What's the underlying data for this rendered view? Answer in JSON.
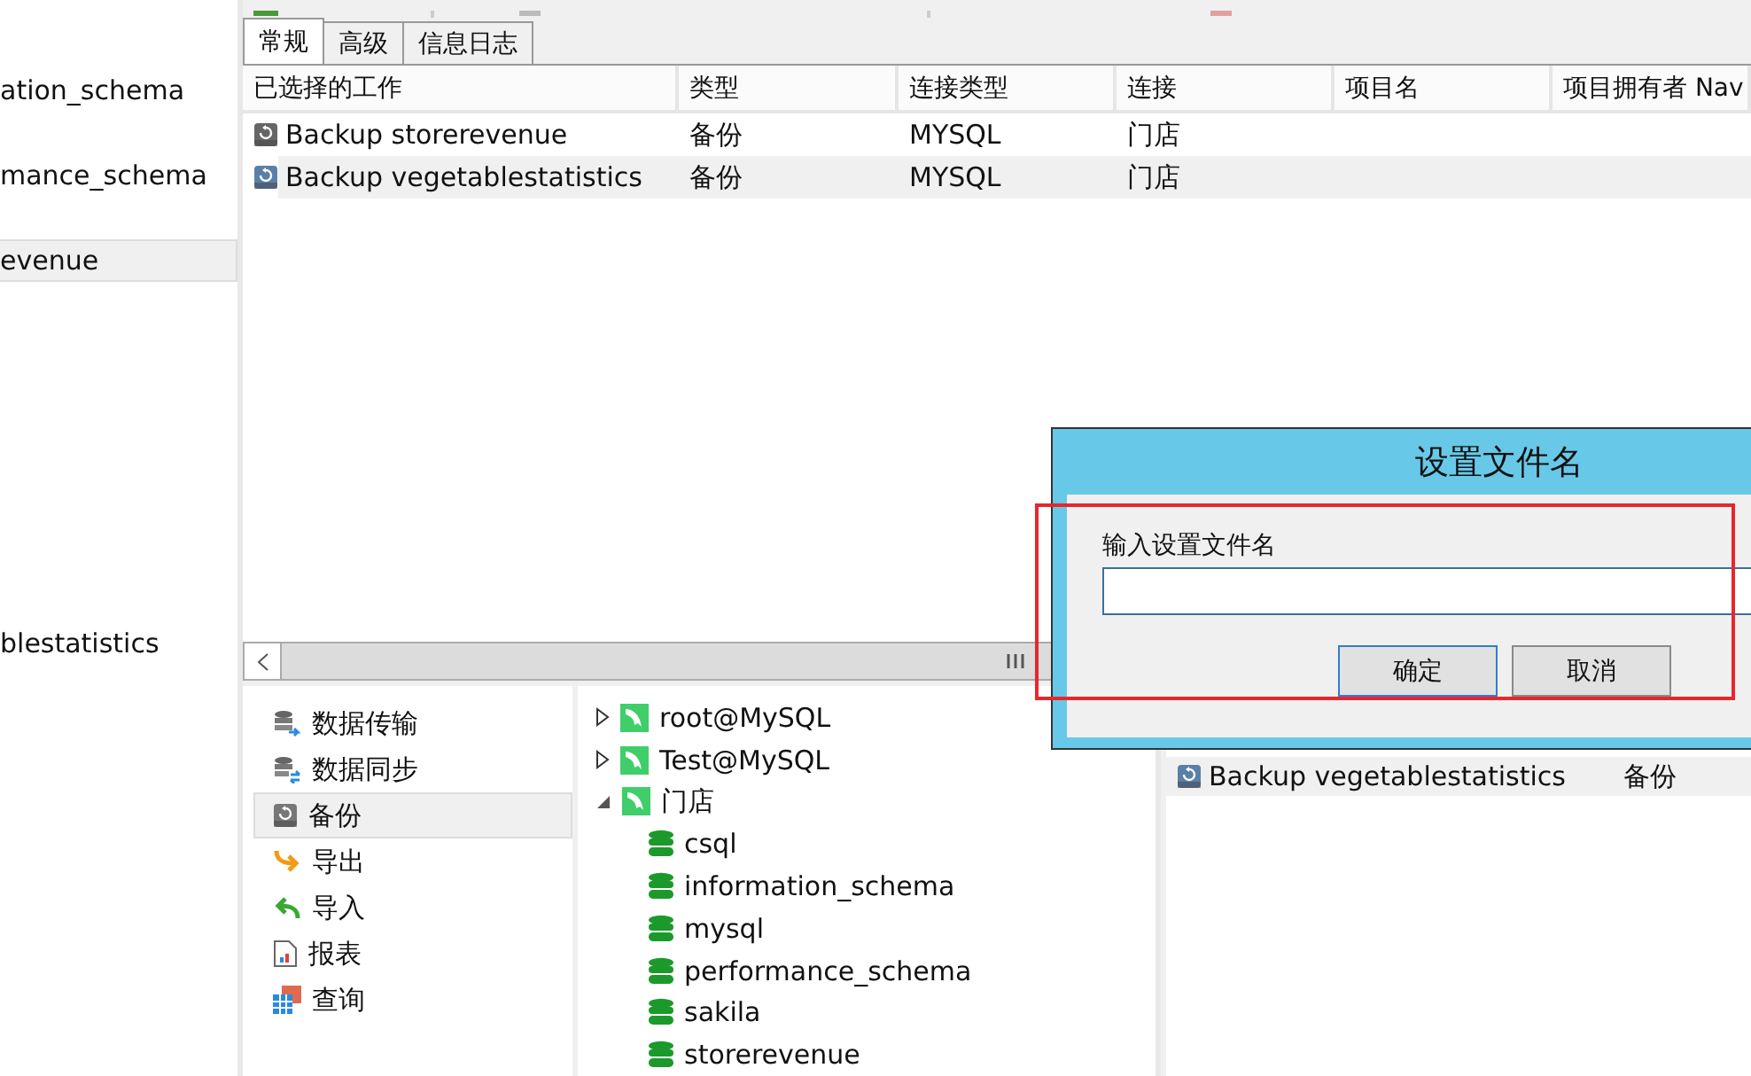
{
  "left_pane": {
    "items": [
      {
        "label": "ation_schema",
        "selected": false
      },
      {
        "label": "mance_schema",
        "selected": false
      },
      {
        "label": "evenue",
        "selected": true
      },
      {
        "label": "blestatistics",
        "selected": false
      }
    ]
  },
  "tabs": [
    {
      "label": "常规",
      "selected": true
    },
    {
      "label": "高级",
      "selected": false
    },
    {
      "label": "信息日志",
      "selected": false
    }
  ],
  "table": {
    "columns": [
      "已选择的工作",
      "类型",
      "连接类型",
      "连接",
      "项目名",
      "项目拥有者 Nav"
    ],
    "rows": [
      {
        "cells": [
          "Backup storerevenue",
          "备份",
          "MYSQL",
          "门店"
        ],
        "selected": false
      },
      {
        "cells": [
          "Backup vegetablestatistics",
          "备份",
          "MYSQL",
          "门店"
        ],
        "selected": true
      }
    ]
  },
  "tools": [
    {
      "label": "数据传输",
      "kind": "transfer",
      "selected": false
    },
    {
      "label": "数据同步",
      "kind": "sync",
      "selected": false
    },
    {
      "label": "备份",
      "kind": "backup",
      "selected": true
    },
    {
      "label": "导出",
      "kind": "export",
      "selected": false
    },
    {
      "label": "导入",
      "kind": "import",
      "selected": false
    },
    {
      "label": "报表",
      "kind": "report",
      "selected": false
    },
    {
      "label": "查询",
      "kind": "query",
      "selected": false
    }
  ],
  "tree": [
    {
      "label": "root@MySQL",
      "expanded": false
    },
    {
      "label": "Test@MySQL",
      "expanded": false
    },
    {
      "label": "门店",
      "expanded": true,
      "children": [
        {
          "label": "csql"
        },
        {
          "label": "information_schema"
        },
        {
          "label": "mysql"
        },
        {
          "label": "performance_schema"
        },
        {
          "label": "sakila"
        },
        {
          "label": "storerevenue"
        }
      ]
    }
  ],
  "job_list": [
    {
      "name": "Backup vegetablestatistics",
      "type": "备份"
    }
  ],
  "dialog": {
    "title": "设置文件名",
    "label": "输入设置文件名",
    "buttons": [
      {
        "label": "确定",
        "default": true
      },
      {
        "label": "取消",
        "default": false
      }
    ]
  }
}
